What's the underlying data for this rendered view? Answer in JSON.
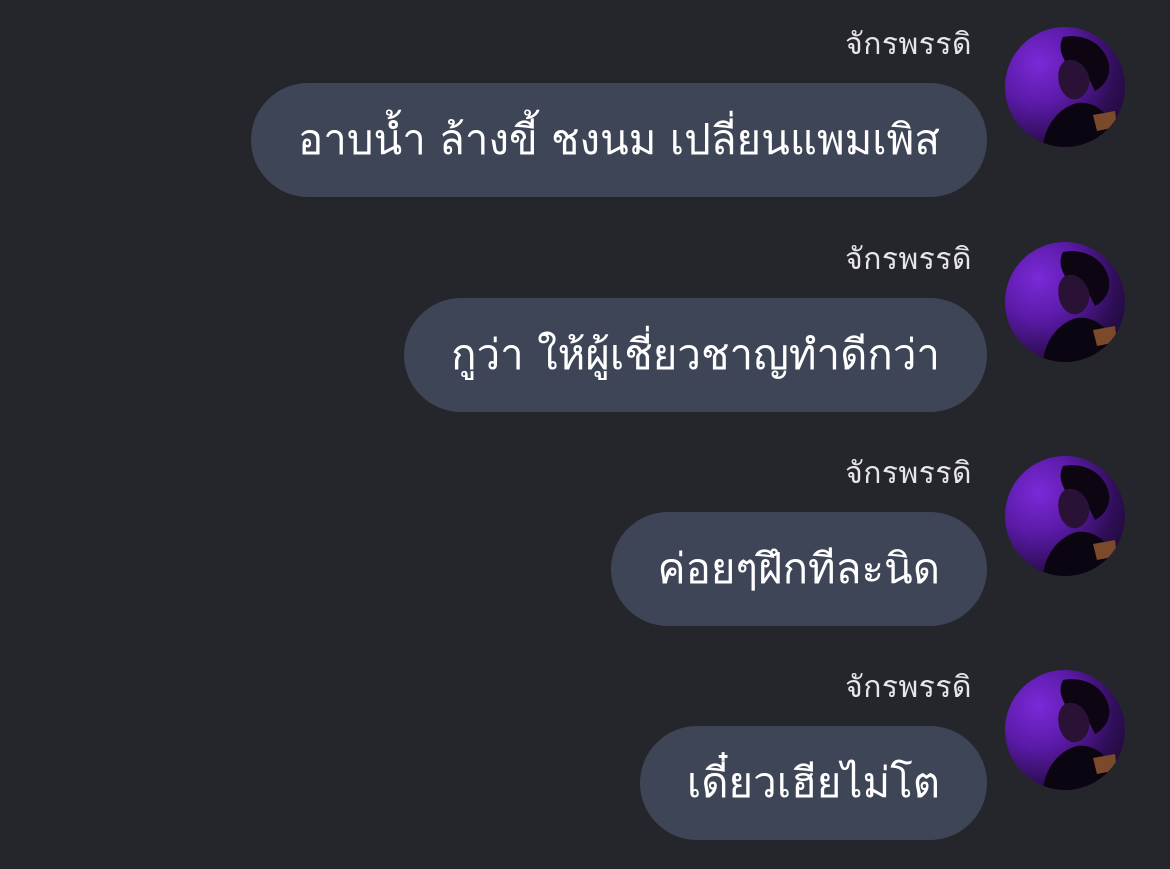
{
  "conversation": {
    "messages": [
      {
        "sender": "จักรพรรดิ",
        "text": "อาบน้ำ ล้างขี้ ชงนม เปลี่ยนแพมเพิส"
      },
      {
        "sender": "จักรพรรดิ",
        "text": "กูว่า ให้ผู้เชี่ยวชาญทำดีกว่า"
      },
      {
        "sender": "จักรพรรดิ",
        "text": "ค่อยๆฝึกทีละนิด"
      },
      {
        "sender": "จักรพรรดิ",
        "text": "เดี๋ยวเฮียไม่โต"
      }
    ]
  },
  "colors": {
    "background": "#25262b",
    "bubble": "#3e4556",
    "bubble_text": "#ffffff",
    "sender_text": "#e6e6ea",
    "avatar_accent": "#6a1fc2"
  }
}
